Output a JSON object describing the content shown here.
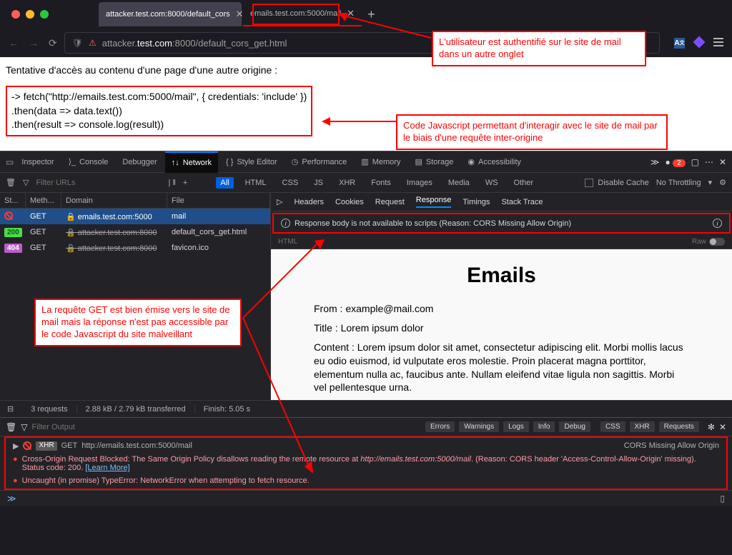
{
  "tabs": [
    {
      "title": "attacker.test.com:8000/default_cors"
    },
    {
      "title": "emails.test.com:5000/mail"
    }
  ],
  "url": {
    "prefix": "attacker.",
    "bold": "test.com",
    "suffix": ":8000/default_cors_get.html"
  },
  "page": {
    "heading": "Tentative d'accès au contenu d'une page d'une autre origine :",
    "code_l1": "-> fetch(\"http://emails.test.com:5000/mail\", { credentials: 'include' })",
    "code_l2": "  .then(data => data.text())",
    "code_l3": "  .then(result => console.log(result))"
  },
  "devtools": {
    "tabs": [
      "Inspector",
      "Console",
      "Debugger",
      "Network",
      "Style Editor",
      "Performance",
      "Memory",
      "Storage",
      "Accessibility"
    ],
    "error_badge": "2",
    "filter_placeholder": "Filter URLs",
    "filter_buttons": [
      "All",
      "HTML",
      "CSS",
      "JS",
      "XHR",
      "Fonts",
      "Images",
      "Media",
      "WS",
      "Other"
    ],
    "disable_cache": "Disable Cache",
    "throttling": "No Throttling",
    "columns": {
      "status": "St...",
      "method": "Meth...",
      "domain": "Domain",
      "file": "File"
    },
    "rows": [
      {
        "status_class": "sb-blocked",
        "status_icon": "⊘",
        "method": "GET",
        "domain": "emails.test.com:5000",
        "file": "mail",
        "strike": false,
        "selected": true
      },
      {
        "status_class": "sb-200",
        "status": "200",
        "method": "GET",
        "domain": "attacker.test.com:8000",
        "file": "default_cors_get.html",
        "strike": true
      },
      {
        "status_class": "sb-404",
        "status": "404",
        "method": "GET",
        "domain": "attacker.test.com:8000",
        "file": "favicon.ico",
        "strike": true
      }
    ],
    "footer": {
      "req": "3 requests",
      "size": "2.88 kB / 2.79 kB transferred",
      "finish": "Finish: 5.05 s"
    },
    "detail_tabs": [
      "Headers",
      "Cookies",
      "Request",
      "Response",
      "Timings",
      "Stack Trace"
    ],
    "cors_banner": "Response body is not available to scripts (Reason: CORS Missing Allow Origin)",
    "html_label": "HTML",
    "raw_label": "Raw"
  },
  "preview": {
    "title": "Emails",
    "from": "From : example@mail.com",
    "subject": "Title : Lorem ipsum dolor",
    "content": "Content : Lorem ipsum dolor sit amet, consectetur adipiscing elit. Morbi mollis lacus eu odio euismod, id vulputate eros molestie. Proin placerat magna porttitor, elementum nulla ac, faucibus ante. Nullam eleifend vitae ligula non sagittis. Morbi vel pellentesque urna."
  },
  "console": {
    "filter_placeholder": "Filter Output",
    "pills": [
      "Errors",
      "Warnings",
      "Logs",
      "Info",
      "Debug",
      "CSS",
      "XHR",
      "Requests"
    ],
    "row1_method": "XHR",
    "row1_verb": "GET",
    "row1_url": "http://emails.test.com:5000/mail",
    "row1_label": "CORS Missing Allow Origin",
    "row2_text": "Cross-Origin Request Blocked: The Same Origin Policy disallows reading the remote resource at ",
    "row2_url": "http://emails.test.com:5000/mail",
    "row2_suffix": ". (Reason: CORS header 'Access-Control-Allow-Origin' missing). Status code: 200. ",
    "row2_link": "[Learn More]",
    "row3_text": "Uncaught (in promise) TypeError: NetworkError when attempting to fetch resource.",
    "prompt": "≫"
  },
  "annotations": {
    "a1": "L'utilisateur est authentifié sur le site de mail dans un autre onglet",
    "a2": "Code Javascript permettant d'interagir avec le site de mail par le biais d'une requête inter-origine",
    "a3": "La requête GET est bien émise vers le site de mail mais la réponse n'est pas accessible par le code Javascript du site malveillant"
  }
}
